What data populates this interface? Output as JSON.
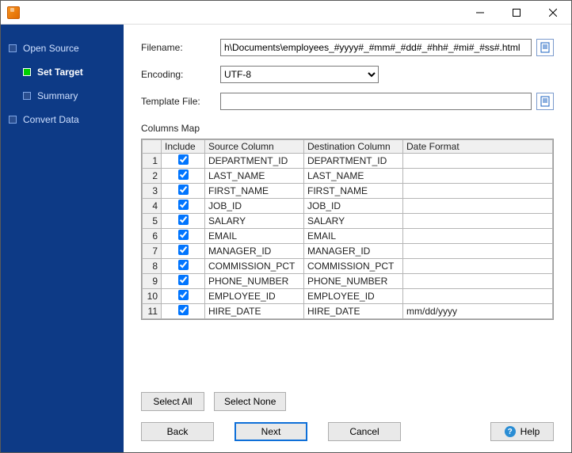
{
  "window": {
    "title": ""
  },
  "nav": {
    "items": [
      {
        "label": "Open Source",
        "active": false,
        "child": false
      },
      {
        "label": "Set Target",
        "active": true,
        "child": true
      },
      {
        "label": "Summary",
        "active": false,
        "child": true
      },
      {
        "label": "Convert Data",
        "active": false,
        "child": false
      }
    ]
  },
  "form": {
    "filename_label": "Filename:",
    "filename_value": "h\\Documents\\employees_#yyyy#_#mm#_#dd#_#hh#_#mi#_#ss#.html",
    "encoding_label": "Encoding:",
    "encoding_value": "UTF-8",
    "template_label": "Template File:",
    "template_value": ""
  },
  "columns_map": {
    "heading": "Columns Map",
    "headers": {
      "include": "Include",
      "source": "Source Column",
      "dest": "Destination Column",
      "fmt": "Date Format"
    },
    "rows": [
      {
        "n": "1",
        "include": true,
        "source": "DEPARTMENT_ID",
        "dest": "DEPARTMENT_ID",
        "fmt": ""
      },
      {
        "n": "2",
        "include": true,
        "source": "LAST_NAME",
        "dest": "LAST_NAME",
        "fmt": ""
      },
      {
        "n": "3",
        "include": true,
        "source": "FIRST_NAME",
        "dest": "FIRST_NAME",
        "fmt": ""
      },
      {
        "n": "4",
        "include": true,
        "source": "JOB_ID",
        "dest": "JOB_ID",
        "fmt": ""
      },
      {
        "n": "5",
        "include": true,
        "source": "SALARY",
        "dest": "SALARY",
        "fmt": ""
      },
      {
        "n": "6",
        "include": true,
        "source": "EMAIL",
        "dest": "EMAIL",
        "fmt": ""
      },
      {
        "n": "7",
        "include": true,
        "source": "MANAGER_ID",
        "dest": "MANAGER_ID",
        "fmt": ""
      },
      {
        "n": "8",
        "include": true,
        "source": "COMMISSION_PCT",
        "dest": "COMMISSION_PCT",
        "fmt": ""
      },
      {
        "n": "9",
        "include": true,
        "source": "PHONE_NUMBER",
        "dest": "PHONE_NUMBER",
        "fmt": ""
      },
      {
        "n": "10",
        "include": true,
        "source": "EMPLOYEE_ID",
        "dest": "EMPLOYEE_ID",
        "fmt": ""
      },
      {
        "n": "11",
        "include": true,
        "source": "HIRE_DATE",
        "dest": "HIRE_DATE",
        "fmt": "mm/dd/yyyy"
      }
    ]
  },
  "buttons": {
    "select_all": "Select All",
    "select_none": "Select None",
    "back": "Back",
    "next": "Next",
    "cancel": "Cancel",
    "help": "Help"
  }
}
